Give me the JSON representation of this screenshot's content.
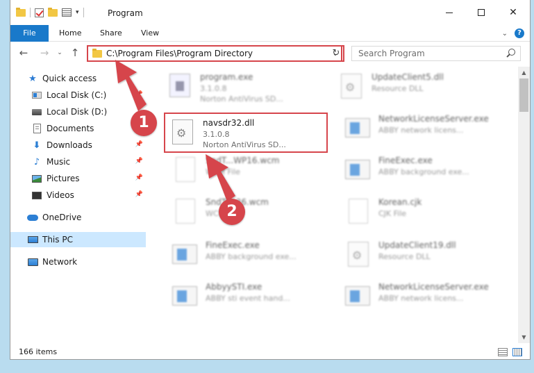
{
  "window": {
    "title": "Program",
    "minimize_glyph": "",
    "close_glyph": "✕"
  },
  "ribbon": {
    "tabs": [
      {
        "label": "File"
      },
      {
        "label": "Home"
      },
      {
        "label": "Share"
      },
      {
        "label": "View"
      }
    ],
    "expand_glyph": "⌄",
    "help_glyph": "?"
  },
  "nav": {
    "back_glyph": "←",
    "forward_glyph": "→",
    "recent_glyph": "⌄",
    "up_glyph": "↑",
    "address": "C:\\Program Files\\Program Directory",
    "address_dropdown_glyph": "⌄",
    "refresh_glyph": "↻",
    "search_placeholder": "Search Program"
  },
  "sidebar": {
    "items": [
      {
        "label": "Quick access",
        "icon": "star-icon"
      },
      {
        "label": "Local Disk (C:)",
        "icon": "drive-c-icon",
        "pinned": true
      },
      {
        "label": "Local Disk (D:)",
        "icon": "drive-icon"
      },
      {
        "label": "Documents",
        "icon": "documents-icon",
        "pinned": true
      },
      {
        "label": "Downloads",
        "icon": "downloads-icon",
        "pinned": true
      },
      {
        "label": "Music",
        "icon": "music-icon",
        "pinned": true
      },
      {
        "label": "Pictures",
        "icon": "pictures-icon",
        "pinned": true
      },
      {
        "label": "Videos",
        "icon": "videos-icon",
        "pinned": true
      },
      {
        "label": "OneDrive",
        "icon": "onedrive-icon"
      },
      {
        "label": "This PC",
        "icon": "this-pc-icon",
        "selected": true
      },
      {
        "label": "Network",
        "icon": "network-icon"
      }
    ],
    "pin_glyph": "📌"
  },
  "files": [
    {
      "name": "program.exe",
      "line1": "3.1.0.8",
      "line2": "Norton AntiVirus SD...",
      "icon": "program-file-icon",
      "faded": true
    },
    {
      "name": "UpdateClient5.dll",
      "line1": "Resource DLL",
      "line2": "",
      "icon": "dll-file-icon",
      "faded": true
    },
    {
      "name": "navsdr32.dll",
      "line1": "3.1.0.8",
      "line2": "Norton AntiVirus SD...",
      "icon": "dll-file-icon",
      "faded": false,
      "highlighted": true
    },
    {
      "name": "NetworkLicenseServer.exe",
      "line1": "ABBY network licens...",
      "line2": "",
      "icon": "exe-file-icon",
      "faded": true
    },
    {
      "name": "SndT...WP16.wcm",
      "line1": "WCM File",
      "line2": "",
      "icon": "blank-file-icon",
      "faded": true
    },
    {
      "name": "FineExec.exe",
      "line1": "ABBY background exe...",
      "line2": "",
      "icon": "exe-file-icon",
      "faded": true
    },
    {
      "name": "SndTr...36.wcm",
      "line1": "WCM File",
      "line2": "",
      "icon": "blank-file-icon",
      "faded": true
    },
    {
      "name": "Korean.cjk",
      "line1": "CJK File",
      "line2": "",
      "icon": "blank-file-icon",
      "faded": true
    },
    {
      "name": "FineExec.exe",
      "line1": "ABBY background exe...",
      "line2": "",
      "icon": "exe-file-icon",
      "faded": true
    },
    {
      "name": "UpdateClient19.dll",
      "line1": "Resource DLL",
      "line2": "",
      "icon": "dll-file-icon",
      "faded": true
    },
    {
      "name": "AbbyySTI.exe",
      "line1": "ABBY sti event hand...",
      "line2": "",
      "icon": "exe-file-icon",
      "faded": true
    },
    {
      "name": "NetworkLicenseServer.exe",
      "line1": "ABBY network licens...",
      "line2": "",
      "icon": "exe-file-icon",
      "faded": true
    }
  ],
  "scrollbar": {
    "up_glyph": "▲",
    "down_glyph": "▼"
  },
  "status": {
    "item_count": "166 items"
  },
  "annotations": {
    "step1": "1",
    "step2": "2",
    "color": "#d6454b"
  }
}
